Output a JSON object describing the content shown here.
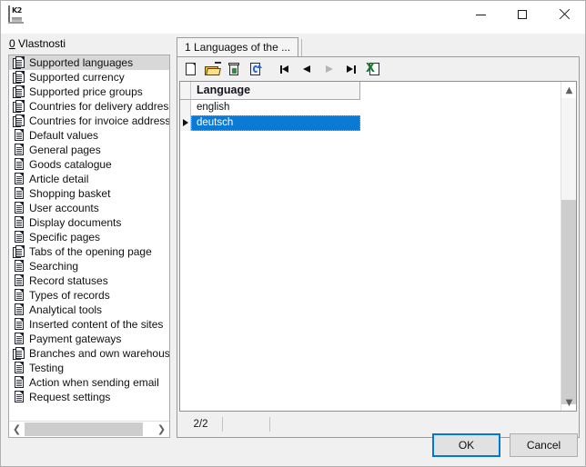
{
  "window": {
    "app_icon": "k2-app-icon",
    "title": "",
    "controls": {
      "minimize": "minimize-button",
      "maximize": "maximize-button",
      "close": "close-button"
    }
  },
  "left_pane": {
    "label_accel": "0",
    "label_text": " Vlastnosti",
    "items": [
      {
        "label": "Supported languages",
        "icon": "multi-document-icon",
        "selected": true
      },
      {
        "label": "Supported currency",
        "icon": "multi-document-icon",
        "selected": false
      },
      {
        "label": "Supported price groups",
        "icon": "multi-document-icon",
        "selected": false
      },
      {
        "label": "Countries for delivery addresses",
        "icon": "multi-document-icon",
        "selected": false
      },
      {
        "label": "Countries for invoice addresses",
        "icon": "multi-document-icon",
        "selected": false
      },
      {
        "label": "Default values",
        "icon": "document-icon",
        "selected": false
      },
      {
        "label": "General pages",
        "icon": "document-icon",
        "selected": false
      },
      {
        "label": "Goods catalogue",
        "icon": "document-icon",
        "selected": false
      },
      {
        "label": "Article detail",
        "icon": "document-icon",
        "selected": false
      },
      {
        "label": "Shopping basket",
        "icon": "document-icon",
        "selected": false
      },
      {
        "label": "User accounts",
        "icon": "document-icon",
        "selected": false
      },
      {
        "label": "Display documents",
        "icon": "document-icon",
        "selected": false
      },
      {
        "label": "Specific pages",
        "icon": "document-icon",
        "selected": false
      },
      {
        "label": "Tabs of the opening page",
        "icon": "multi-document-icon",
        "selected": false
      },
      {
        "label": "Searching",
        "icon": "document-icon",
        "selected": false
      },
      {
        "label": "Record statuses",
        "icon": "document-icon",
        "selected": false
      },
      {
        "label": "Types of records",
        "icon": "document-icon",
        "selected": false
      },
      {
        "label": "Analytical tools",
        "icon": "document-icon",
        "selected": false
      },
      {
        "label": "Inserted content of the sites",
        "icon": "document-icon",
        "selected": false
      },
      {
        "label": "Payment gateways",
        "icon": "document-icon",
        "selected": false
      },
      {
        "label": "Branches and own warehouses",
        "icon": "multi-document-icon",
        "selected": false
      },
      {
        "label": "Testing",
        "icon": "document-icon",
        "selected": false
      },
      {
        "label": "Action when sending email",
        "icon": "document-icon",
        "selected": false
      },
      {
        "label": "Request settings",
        "icon": "document-icon",
        "selected": false
      }
    ]
  },
  "right_pane": {
    "tabs": [
      {
        "label": "1 Languages of the ...",
        "active": true
      }
    ],
    "toolbar": [
      {
        "name": "new-record-button",
        "icon": "new-document-icon",
        "enabled": true
      },
      {
        "name": "open-record-button",
        "icon": "open-folder-icon",
        "enabled": true
      },
      {
        "name": "delete-record-button",
        "icon": "recycle-bin-icon",
        "enabled": true
      },
      {
        "name": "refresh-record-button",
        "icon": "refresh-document-icon",
        "enabled": true
      },
      {
        "name": "first-record-button",
        "icon": "navigate-first-icon",
        "enabled": true
      },
      {
        "name": "previous-record-button",
        "icon": "navigate-previous-icon",
        "enabled": true
      },
      {
        "name": "next-record-button",
        "icon": "navigate-next-icon",
        "enabled": false
      },
      {
        "name": "last-record-button",
        "icon": "navigate-last-icon",
        "enabled": true
      },
      {
        "name": "export-excel-button",
        "icon": "export-excel-icon",
        "enabled": true
      }
    ],
    "grid": {
      "columns": [
        "Language"
      ],
      "rows": [
        {
          "cells": [
            "english"
          ],
          "selected": false
        },
        {
          "cells": [
            "deutsch"
          ],
          "selected": true
        }
      ]
    },
    "status": {
      "record_counter": "2/2",
      "cell_2": "",
      "cell_3": ""
    }
  },
  "footer": {
    "ok_label": "OK",
    "cancel_label": "Cancel"
  },
  "colors": {
    "selection_blue": "#0b7ad4",
    "focus_border": "#0078d7",
    "list_selection_gray": "#d8d8d8",
    "window_bg": "#f0f0f0"
  }
}
